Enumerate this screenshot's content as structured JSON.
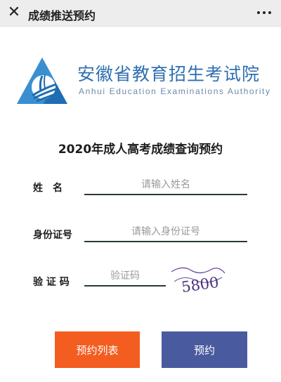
{
  "header": {
    "title": "成绩推送预约",
    "close_icon": "close-icon",
    "more_icon": "more-icon"
  },
  "logo": {
    "name_cn": "安徽省教育招生考试院",
    "name_en": "Anhui Education Examinations Authority",
    "brand_color": "#2f6fb1"
  },
  "form": {
    "title": "2020年成人高考成绩查询预约",
    "name_label": "姓　名",
    "name_placeholder": "请输入姓名",
    "id_label": "身份证号",
    "id_placeholder": "请输入身份证号",
    "captcha_label": "验 证 码",
    "captcha_placeholder": "验证码",
    "captcha_text": "5800"
  },
  "buttons": {
    "list_label": "预约列表",
    "list_color": "#f35d1f",
    "reserve_label": "预约",
    "reserve_color": "#4a5a9e"
  }
}
